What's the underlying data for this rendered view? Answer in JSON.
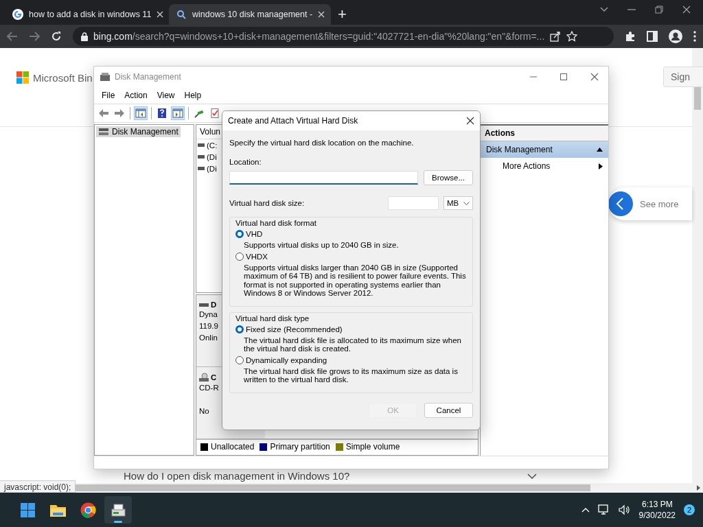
{
  "browser": {
    "tabs": [
      {
        "title": "how to add a disk in windows 11",
        "kind": "google",
        "selected": false
      },
      {
        "title": "windows 10 disk management -",
        "kind": "search",
        "selected": true
      }
    ],
    "new_tab": "+",
    "address": {
      "domain": "bing.com",
      "path": "/search?q=windows+10+disk+management&filters=guid:\"4027721-en-dia\"%20lang:\"en\"&form=..."
    }
  },
  "page": {
    "logo": "Microsoft Bin",
    "sign_in": "Sign",
    "see_more": "See more",
    "faq_question": "How do I open disk management in Windows 10?",
    "status_link": "javascript: void(0);"
  },
  "disk_management": {
    "title": "Disk Management",
    "menu": [
      "File",
      "Action",
      "View",
      "Help"
    ],
    "toolbar": [
      {
        "kind": "back",
        "on": false
      },
      {
        "kind": "forward",
        "on": false
      },
      {
        "kind": "sep"
      },
      {
        "kind": "tree",
        "on": true
      },
      {
        "kind": "sep"
      },
      {
        "kind": "help",
        "on": false
      },
      {
        "kind": "pane",
        "on": true
      },
      {
        "kind": "sep"
      },
      {
        "kind": "plug",
        "on": false
      },
      {
        "kind": "check",
        "on": false
      }
    ],
    "tree": [
      {
        "label": "Disk Management",
        "selected": true
      }
    ],
    "volume_header": "Volun",
    "volumes": [
      "(C:",
      "(Di",
      "(Di"
    ],
    "disks": [
      {
        "kind": "disk",
        "name": "D",
        "type": "Dyna",
        "size": "119.9",
        "status": "Onlin"
      },
      {
        "kind": "cd",
        "name": "C",
        "type": "CD-R",
        "status": "No"
      }
    ],
    "legend": [
      {
        "label": "Unallocated",
        "color": "#000000"
      },
      {
        "label": "Primary partition",
        "color": "#000080"
      },
      {
        "label": "Simple volume",
        "color": "#808000"
      }
    ],
    "actions": {
      "header": "Actions",
      "items": [
        {
          "label": "Disk Management",
          "kind": "section",
          "selected": true
        },
        {
          "label": "More Actions",
          "kind": "submenu",
          "selected": false
        }
      ]
    }
  },
  "dialog": {
    "title": "Create and Attach Virtual Hard Disk",
    "intro": "Specify the virtual hard disk location on the machine.",
    "location_label": "Location:",
    "browse": "Browse...",
    "size_label": "Virtual hard disk size:",
    "unit": "MB",
    "groups": [
      {
        "title": "Virtual hard disk format",
        "options": [
          {
            "label": "VHD",
            "selected": true,
            "description": "Supports virtual disks up to 2040 GB in size."
          },
          {
            "label": "VHDX",
            "selected": false,
            "description": "Supports virtual disks larger than 2040 GB in size (Supported maximum of 64 TB) and is resilient to power failure events. This format is not supported in operating systems earlier than Windows 8 or Windows Server 2012."
          }
        ]
      },
      {
        "title": "Virtual hard disk type",
        "options": [
          {
            "label": "Fixed size (Recommended)",
            "selected": true,
            "description": "The virtual hard disk file is allocated to its maximum size when the virtual hard disk is created."
          },
          {
            "label": "Dynamically expanding",
            "selected": false,
            "description": "The virtual hard disk file grows to its maximum size as data is written to the virtual hard disk."
          }
        ]
      }
    ],
    "buttons": [
      {
        "label": "OK",
        "disabled": true
      },
      {
        "label": "Cancel",
        "disabled": false
      }
    ]
  },
  "taskbar": {
    "apps": [
      {
        "kind": "start",
        "active": false
      },
      {
        "kind": "folder",
        "active": false
      },
      {
        "kind": "chrome",
        "active": false
      },
      {
        "kind": "diskmgmt",
        "active": true
      }
    ],
    "time": "6:13 PM",
    "date": "9/30/2022",
    "notifications": "2"
  }
}
